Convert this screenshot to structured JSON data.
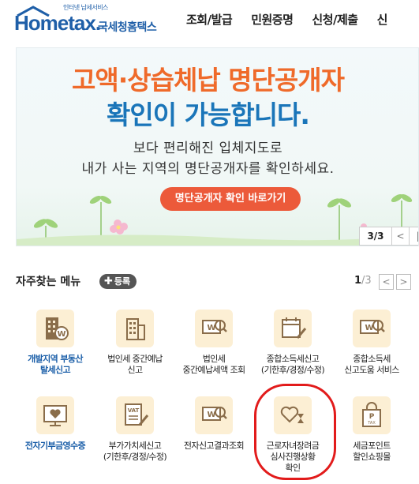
{
  "header": {
    "logo_tagline": "인터넷 납세서비스",
    "logo_main": "Hometax.",
    "logo_sub": "국세청홈택스",
    "nav": [
      "조회/발급",
      "민원증명",
      "신청/제출",
      "신"
    ]
  },
  "banner": {
    "line1": "고액·상습체납 명단공개자",
    "line2": "확인이 가능합니다.",
    "sub1": "보다 편리해진 입체지도로",
    "sub2": "내가 사는 지역의 명단공개자를 확인하세요.",
    "button": "명단공개자 확인 바로가기",
    "pager": {
      "count": "3/3",
      "prev": "<",
      "next": "|"
    }
  },
  "favorites": {
    "title": "자주찾는 메뉴",
    "add_label": "등록",
    "page_current": "1",
    "page_total": "/3",
    "prev": "<",
    "next": ">",
    "items": [
      {
        "label_lines": [
          "개발지역 부동산",
          "탈세신고"
        ],
        "icon": "building-w-icon",
        "emphasis": true
      },
      {
        "label_lines": [
          "법인세 중간예납",
          "신고"
        ],
        "icon": "building-icon",
        "emphasis": false
      },
      {
        "label_lines": [
          "법인세",
          "중간예납세액 조회"
        ],
        "icon": "won-search-icon",
        "emphasis": false
      },
      {
        "label_lines": [
          "종합소득세신고",
          "(기한후/경정/수정)"
        ],
        "icon": "calendar-pen-icon",
        "emphasis": false
      },
      {
        "label_lines": [
          "종합소득세",
          "신고도움 서비스"
        ],
        "icon": "won-search-icon",
        "emphasis": false
      },
      {
        "label_lines": [
          "전자기부금영수증"
        ],
        "icon": "monitor-heart-icon",
        "emphasis": true
      },
      {
        "label_lines": [
          "부가가치세신고",
          "(기한후/경정/수정)"
        ],
        "icon": "vat-document-icon",
        "emphasis": false
      },
      {
        "label_lines": [
          "전자신고결과조회"
        ],
        "icon": "won-search-icon",
        "emphasis": false
      },
      {
        "label_lines": [
          "근로자녀장려금",
          "심사진행상황",
          "확인"
        ],
        "icon": "heart-hourglass-icon",
        "emphasis": false
      },
      {
        "label_lines": [
          "세금포인트",
          "할인쇼핑몰"
        ],
        "icon": "shopping-bag-icon",
        "emphasis": false
      }
    ]
  },
  "colors": {
    "brand_blue": "#1f5fa8",
    "banner_orange": "#ef6a2a",
    "banner_blue": "#1a75b9",
    "banner_button": "#ec5a3a",
    "tile_bg": "#fcefd4",
    "highlight": "#e21b1b"
  }
}
